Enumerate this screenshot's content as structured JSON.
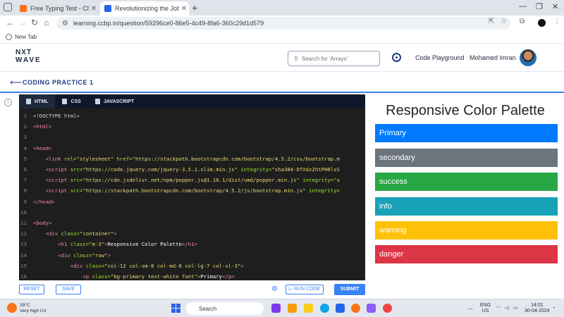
{
  "browser": {
    "tabs": [
      {
        "title": "Free Typing Test - Check Your T",
        "favicon_color": "#f97316"
      },
      {
        "title": "Revolutionizing the Job Market",
        "favicon_color": "#2563eb"
      }
    ],
    "url": "learning.ccbp.in/question/59296ce0-86e5-4c49-8fa6-360c29d1d579",
    "bookmark": "New Tab"
  },
  "site": {
    "logo_line1": "NXT",
    "logo_line2": "WAVE",
    "search_placeholder": "Search for 'Arrays'",
    "code_playground": "Code Playground",
    "user_name": "Mohamed Imran"
  },
  "page": {
    "title": "CODING PRACTICE 1"
  },
  "editor": {
    "tabs": [
      "HTML",
      "CSS",
      "JAVASCRIPT"
    ],
    "lines": [
      {
        "n": "1",
        "indent": "",
        "tokens": [
          [
            "ct",
            "<!DOCTYPE html>"
          ]
        ]
      },
      {
        "n": "2",
        "indent": "",
        "tokens": [
          [
            "tg",
            "<html>"
          ]
        ]
      },
      {
        "n": "3",
        "indent": "",
        "tokens": []
      },
      {
        "n": "4",
        "indent": "",
        "tokens": [
          [
            "tg",
            "<head>"
          ]
        ]
      },
      {
        "n": "5",
        "indent": "    ",
        "tokens": [
          [
            "tg",
            "<link "
          ],
          [
            "at",
            "rel="
          ],
          [
            "vl",
            "\"stylesheet\" "
          ],
          [
            "at",
            "href="
          ],
          [
            "vl",
            "\"https://stackpath.bootstrapcdn.com/bootstrap/4.5.2/css/bootstrap.m"
          ]
        ]
      },
      {
        "n": "6",
        "indent": "    ",
        "tokens": [
          [
            "tg",
            "<script "
          ],
          [
            "at",
            "src="
          ],
          [
            "vl",
            "\"https://code.jquery.com/jquery-3.5.1.slim.min.js\" "
          ],
          [
            "at",
            "integrity="
          ],
          [
            "vl",
            "\"sha384-DfXdz2htPH0lsS"
          ]
        ]
      },
      {
        "n": "7",
        "indent": "    ",
        "tokens": [
          [
            "tg",
            "<script "
          ],
          [
            "at",
            "src="
          ],
          [
            "vl",
            "\"https://cdn.jsdelivr.net/npm/popper.js@1.16.1/dist/umd/popper.min.js\" "
          ],
          [
            "at",
            "integrity="
          ],
          [
            "vl",
            "\"s"
          ]
        ]
      },
      {
        "n": "8",
        "indent": "    ",
        "tokens": [
          [
            "tg",
            "<script "
          ],
          [
            "at",
            "src="
          ],
          [
            "vl",
            "\"https://stackpath.bootstrapcdn.com/bootstrap/4.5.2/js/bootstrap.min.js\" "
          ],
          [
            "at",
            "integrity="
          ]
        ]
      },
      {
        "n": "9",
        "indent": "",
        "tokens": [
          [
            "tg",
            "</head>"
          ]
        ]
      },
      {
        "n": "10",
        "indent": "",
        "tokens": []
      },
      {
        "n": "11",
        "indent": "",
        "tokens": [
          [
            "tg",
            "<body>"
          ]
        ]
      },
      {
        "n": "12",
        "indent": "    ",
        "tokens": [
          [
            "tg",
            "<div "
          ],
          [
            "at",
            "class="
          ],
          [
            "vl",
            "\"container\""
          ],
          [
            "tg",
            ">"
          ]
        ]
      },
      {
        "n": "13",
        "indent": "        ",
        "tokens": [
          [
            "tg",
            "<h1 "
          ],
          [
            "at",
            "class="
          ],
          [
            "vl",
            "\"m-3\""
          ],
          [
            "tg",
            ">"
          ],
          [
            "tx",
            "Responsive Color Palette"
          ],
          [
            "tg",
            "</h1>"
          ]
        ]
      },
      {
        "n": "14",
        "indent": "        ",
        "tokens": [
          [
            "tg",
            "<div "
          ],
          [
            "at",
            "class="
          ],
          [
            "vl",
            "\"row\""
          ],
          [
            "tg",
            ">"
          ]
        ]
      },
      {
        "n": "15",
        "indent": "            ",
        "tokens": [
          [
            "tg",
            "<div "
          ],
          [
            "at",
            "class="
          ],
          [
            "vl",
            "\"col-12 col-sm-8 col-md-6 col-lg-7 col-xl-3\""
          ],
          [
            "tg",
            ">"
          ]
        ]
      },
      {
        "n": "16",
        "indent": "                ",
        "tokens": [
          [
            "tg",
            "<p "
          ],
          [
            "at",
            "class="
          ],
          [
            "vl",
            "\"bg-primary text-white font\""
          ],
          [
            "tg",
            ">"
          ],
          [
            "tx",
            "Primary"
          ],
          [
            "tg",
            "</p>"
          ]
        ]
      }
    ],
    "buttons": {
      "reset": "RESET",
      "save": "SAVE",
      "run": "RUN CODE",
      "submit": "SUBMIT"
    }
  },
  "preview": {
    "heading": "Responsive Color Palette",
    "swatches": [
      {
        "label": "Primary",
        "color": "#007bff"
      },
      {
        "label": "secondary",
        "color": "#6c757d"
      },
      {
        "label": "success",
        "color": "#28a745"
      },
      {
        "label": "info",
        "color": "#17a2b8"
      },
      {
        "label": "warning",
        "color": "#ffc107"
      },
      {
        "label": "danger",
        "color": "#dc3545"
      }
    ]
  },
  "taskbar": {
    "temp": "39°C",
    "weather": "Very high UV",
    "search": "Search",
    "lang1": "ENG",
    "lang2": "US",
    "time": "14:01",
    "date": "30-04-2024"
  }
}
